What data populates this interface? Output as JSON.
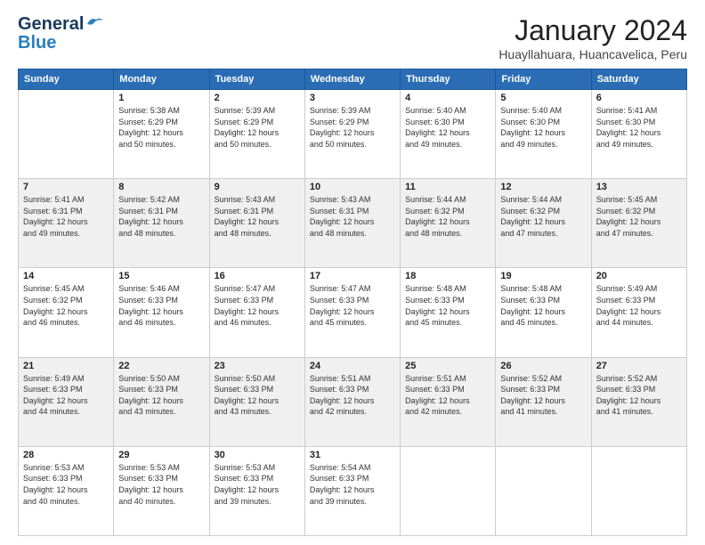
{
  "header": {
    "logo_line1": "General",
    "logo_line2": "Blue",
    "month": "January 2024",
    "location": "Huayllahuara, Huancavelica, Peru"
  },
  "weekdays": [
    "Sunday",
    "Monday",
    "Tuesday",
    "Wednesday",
    "Thursday",
    "Friday",
    "Saturday"
  ],
  "weeks": [
    [
      {
        "day": "",
        "info": ""
      },
      {
        "day": "1",
        "info": "Sunrise: 5:38 AM\nSunset: 6:29 PM\nDaylight: 12 hours\nand 50 minutes."
      },
      {
        "day": "2",
        "info": "Sunrise: 5:39 AM\nSunset: 6:29 PM\nDaylight: 12 hours\nand 50 minutes."
      },
      {
        "day": "3",
        "info": "Sunrise: 5:39 AM\nSunset: 6:29 PM\nDaylight: 12 hours\nand 50 minutes."
      },
      {
        "day": "4",
        "info": "Sunrise: 5:40 AM\nSunset: 6:30 PM\nDaylight: 12 hours\nand 49 minutes."
      },
      {
        "day": "5",
        "info": "Sunrise: 5:40 AM\nSunset: 6:30 PM\nDaylight: 12 hours\nand 49 minutes."
      },
      {
        "day": "6",
        "info": "Sunrise: 5:41 AM\nSunset: 6:30 PM\nDaylight: 12 hours\nand 49 minutes."
      }
    ],
    [
      {
        "day": "7",
        "info": "Sunrise: 5:41 AM\nSunset: 6:31 PM\nDaylight: 12 hours\nand 49 minutes."
      },
      {
        "day": "8",
        "info": "Sunrise: 5:42 AM\nSunset: 6:31 PM\nDaylight: 12 hours\nand 48 minutes."
      },
      {
        "day": "9",
        "info": "Sunrise: 5:43 AM\nSunset: 6:31 PM\nDaylight: 12 hours\nand 48 minutes."
      },
      {
        "day": "10",
        "info": "Sunrise: 5:43 AM\nSunset: 6:31 PM\nDaylight: 12 hours\nand 48 minutes."
      },
      {
        "day": "11",
        "info": "Sunrise: 5:44 AM\nSunset: 6:32 PM\nDaylight: 12 hours\nand 48 minutes."
      },
      {
        "day": "12",
        "info": "Sunrise: 5:44 AM\nSunset: 6:32 PM\nDaylight: 12 hours\nand 47 minutes."
      },
      {
        "day": "13",
        "info": "Sunrise: 5:45 AM\nSunset: 6:32 PM\nDaylight: 12 hours\nand 47 minutes."
      }
    ],
    [
      {
        "day": "14",
        "info": "Sunrise: 5:45 AM\nSunset: 6:32 PM\nDaylight: 12 hours\nand 46 minutes."
      },
      {
        "day": "15",
        "info": "Sunrise: 5:46 AM\nSunset: 6:33 PM\nDaylight: 12 hours\nand 46 minutes."
      },
      {
        "day": "16",
        "info": "Sunrise: 5:47 AM\nSunset: 6:33 PM\nDaylight: 12 hours\nand 46 minutes."
      },
      {
        "day": "17",
        "info": "Sunrise: 5:47 AM\nSunset: 6:33 PM\nDaylight: 12 hours\nand 45 minutes."
      },
      {
        "day": "18",
        "info": "Sunrise: 5:48 AM\nSunset: 6:33 PM\nDaylight: 12 hours\nand 45 minutes."
      },
      {
        "day": "19",
        "info": "Sunrise: 5:48 AM\nSunset: 6:33 PM\nDaylight: 12 hours\nand 45 minutes."
      },
      {
        "day": "20",
        "info": "Sunrise: 5:49 AM\nSunset: 6:33 PM\nDaylight: 12 hours\nand 44 minutes."
      }
    ],
    [
      {
        "day": "21",
        "info": "Sunrise: 5:49 AM\nSunset: 6:33 PM\nDaylight: 12 hours\nand 44 minutes."
      },
      {
        "day": "22",
        "info": "Sunrise: 5:50 AM\nSunset: 6:33 PM\nDaylight: 12 hours\nand 43 minutes."
      },
      {
        "day": "23",
        "info": "Sunrise: 5:50 AM\nSunset: 6:33 PM\nDaylight: 12 hours\nand 43 minutes."
      },
      {
        "day": "24",
        "info": "Sunrise: 5:51 AM\nSunset: 6:33 PM\nDaylight: 12 hours\nand 42 minutes."
      },
      {
        "day": "25",
        "info": "Sunrise: 5:51 AM\nSunset: 6:33 PM\nDaylight: 12 hours\nand 42 minutes."
      },
      {
        "day": "26",
        "info": "Sunrise: 5:52 AM\nSunset: 6:33 PM\nDaylight: 12 hours\nand 41 minutes."
      },
      {
        "day": "27",
        "info": "Sunrise: 5:52 AM\nSunset: 6:33 PM\nDaylight: 12 hours\nand 41 minutes."
      }
    ],
    [
      {
        "day": "28",
        "info": "Sunrise: 5:53 AM\nSunset: 6:33 PM\nDaylight: 12 hours\nand 40 minutes."
      },
      {
        "day": "29",
        "info": "Sunrise: 5:53 AM\nSunset: 6:33 PM\nDaylight: 12 hours\nand 40 minutes."
      },
      {
        "day": "30",
        "info": "Sunrise: 5:53 AM\nSunset: 6:33 PM\nDaylight: 12 hours\nand 39 minutes."
      },
      {
        "day": "31",
        "info": "Sunrise: 5:54 AM\nSunset: 6:33 PM\nDaylight: 12 hours\nand 39 minutes."
      },
      {
        "day": "",
        "info": ""
      },
      {
        "day": "",
        "info": ""
      },
      {
        "day": "",
        "info": ""
      }
    ]
  ]
}
